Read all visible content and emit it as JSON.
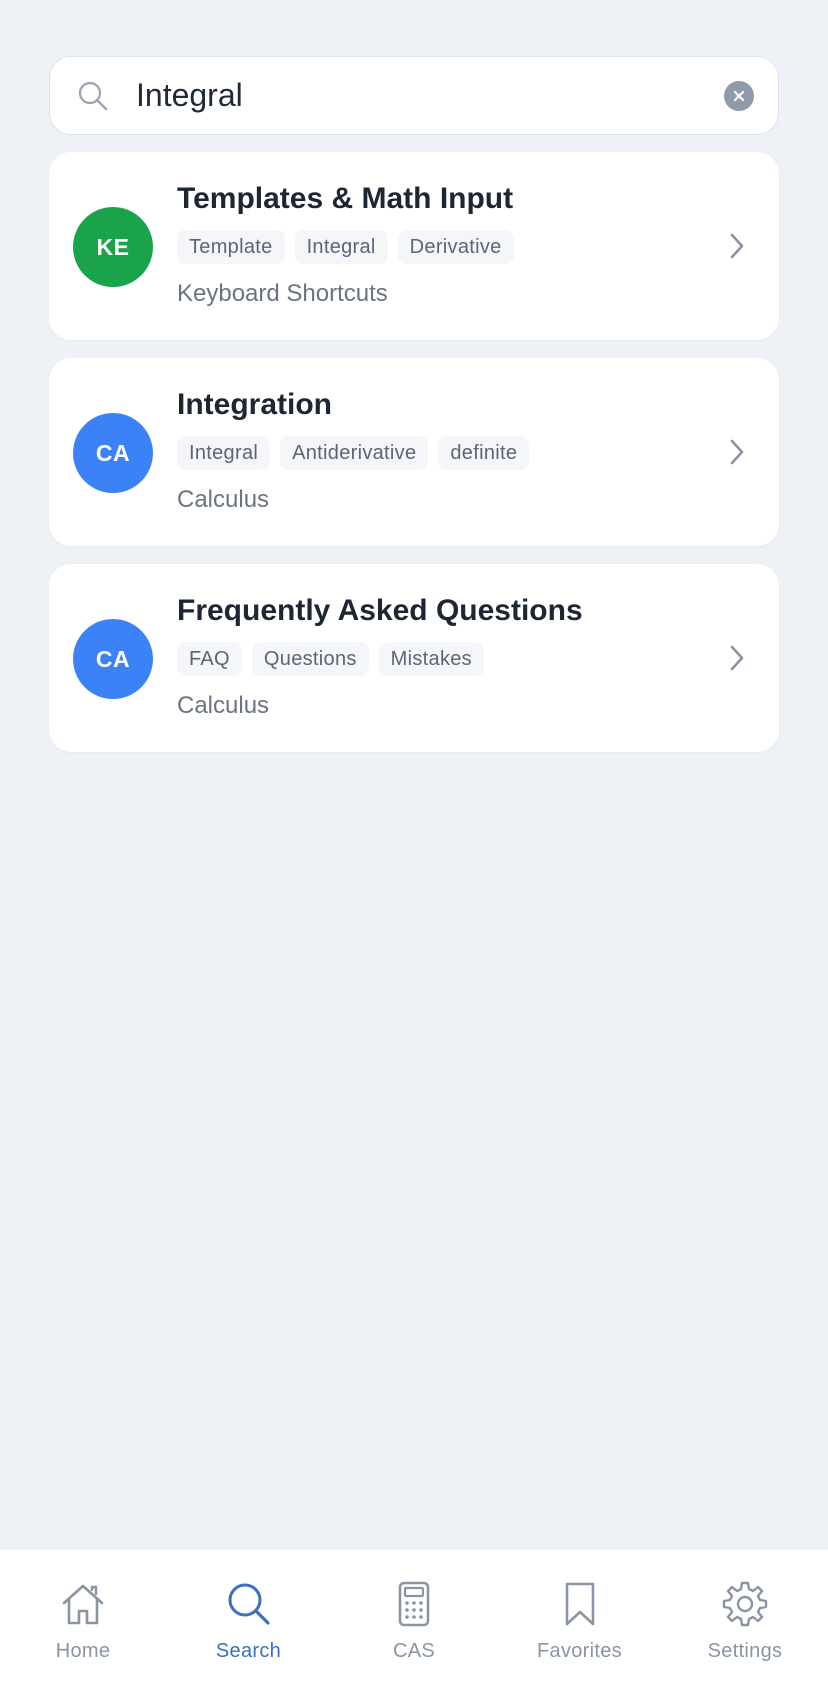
{
  "search": {
    "value": "Integral",
    "icon": "search-icon",
    "clear_icon": "clear-icon"
  },
  "results": [
    {
      "avatar": "KE",
      "avatar_color": "#1aa34a",
      "title": "Templates & Math Input",
      "tags": [
        "Template",
        "Integral",
        "Derivative"
      ],
      "subtitle": "Keyboard Shortcuts"
    },
    {
      "avatar": "CA",
      "avatar_color": "#3b82f6",
      "title": "Integration",
      "tags": [
        "Integral",
        "Antiderivative",
        "definite"
      ],
      "subtitle": "Calculus"
    },
    {
      "avatar": "CA",
      "avatar_color": "#3b82f6",
      "title": "Frequently Asked Questions",
      "tags": [
        "FAQ",
        "Questions",
        "Mistakes"
      ],
      "subtitle": "Calculus"
    }
  ],
  "tabs": [
    {
      "label": "Home",
      "icon": "home-icon",
      "active": false
    },
    {
      "label": "Search",
      "icon": "search-icon",
      "active": true
    },
    {
      "label": "CAS",
      "icon": "calculator-icon",
      "active": false
    },
    {
      "label": "Favorites",
      "icon": "bookmark-icon",
      "active": false
    },
    {
      "label": "Settings",
      "icon": "gear-icon",
      "active": false
    }
  ],
  "colors": {
    "background": "#eef2f7",
    "active_tab": "#3a6fc4",
    "inactive_tab": "#8a94a3"
  }
}
